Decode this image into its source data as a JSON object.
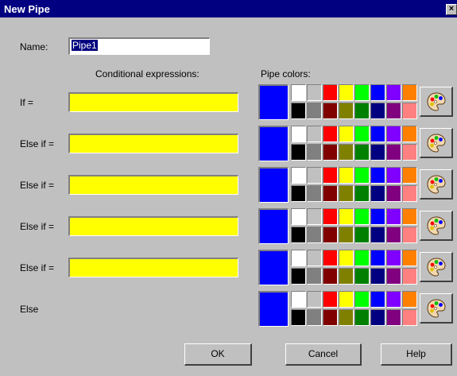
{
  "window": {
    "title": "New Pipe",
    "close_label": "×"
  },
  "name": {
    "label": "Name:",
    "value": "Pipe1"
  },
  "headers": {
    "expressions": "Conditional expressions:",
    "colors": "Pipe colors:"
  },
  "rows": [
    {
      "label": "If =",
      "expression": "",
      "selected_color": "#0000ff"
    },
    {
      "label": "Else if =",
      "expression": "",
      "selected_color": "#0000ff"
    },
    {
      "label": "Else if =",
      "expression": "",
      "selected_color": "#0000ff"
    },
    {
      "label": "Else if =",
      "expression": "",
      "selected_color": "#0000ff"
    },
    {
      "label": "Else if =",
      "expression": "",
      "selected_color": "#0000ff"
    },
    {
      "label": "Else",
      "selected_color": "#0000ff"
    }
  ],
  "palette": {
    "top": [
      "#ffffff",
      "#c0c0c0",
      "#ff0000",
      "#ffff00",
      "#00ff00",
      "#0000ff",
      "#8000ff",
      "#ff8000"
    ],
    "bottom": [
      "#000000",
      "#808080",
      "#800000",
      "#808000",
      "#008000",
      "#000080",
      "#800080",
      "#ff8080"
    ]
  },
  "buttons": {
    "ok": "OK",
    "cancel": "Cancel",
    "help": "Help"
  },
  "colors": {
    "titlebar": "#000080",
    "face": "#c0c0c0",
    "expression_fill": "#ffff00"
  }
}
